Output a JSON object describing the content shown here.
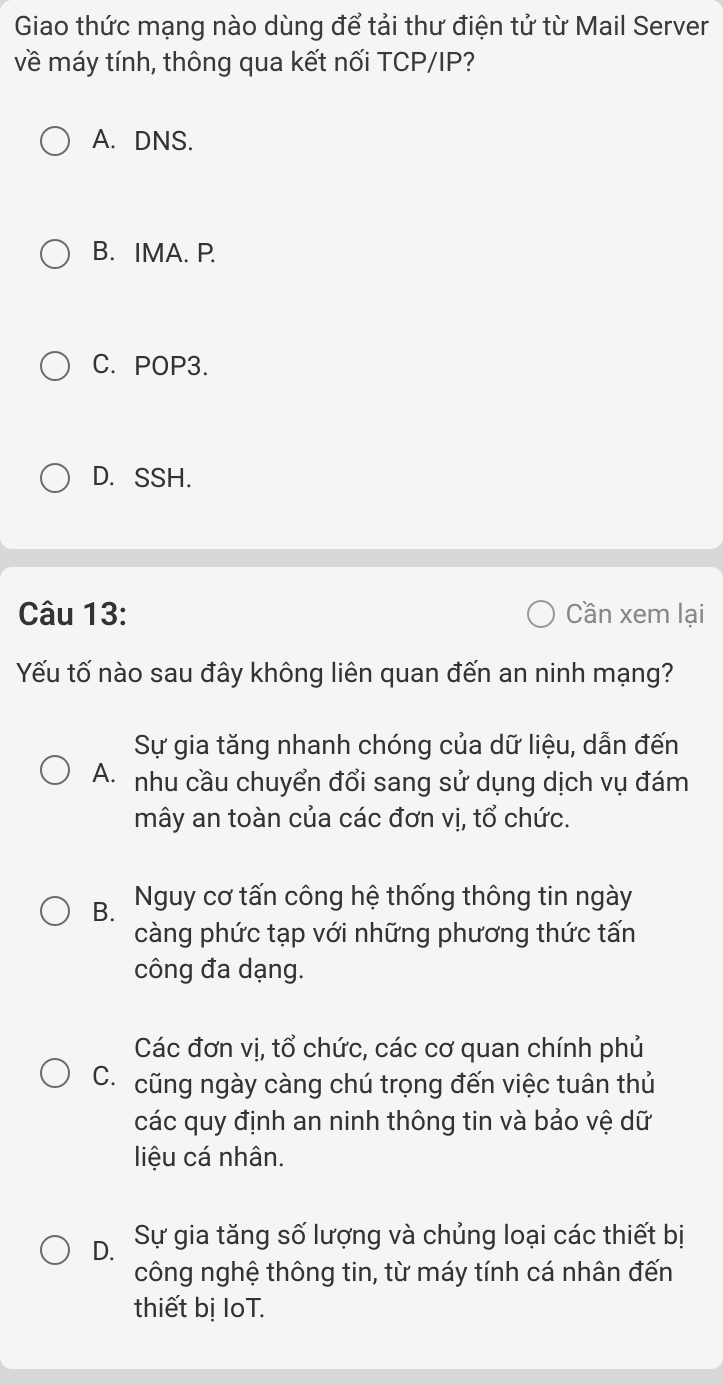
{
  "q12": {
    "prompt": "Giao thức mạng nào dùng để tải thư điện tử từ Mail Server về máy tính, thông qua kết nối TCP/IP?",
    "options": {
      "a": {
        "letter": "A.",
        "text": "DNS."
      },
      "b": {
        "letter": "B.",
        "text": "IMA. P."
      },
      "c": {
        "letter": "C.",
        "text": "POP3."
      },
      "d": {
        "letter": "D.",
        "text": "SSH."
      }
    }
  },
  "q13": {
    "number": "Câu 13:",
    "review_label": "Cần xem lại",
    "prompt": "Yếu tố nào sau đây không liên quan đến an ninh mạng?",
    "options": {
      "a": {
        "letter": "A.",
        "text": "Sự gia tăng nhanh chóng của dữ liệu, dẫn đến nhu cầu chuyển đổi sang sử dụng dịch vụ đám mây an toàn của các đơn vị, tổ chức."
      },
      "b": {
        "letter": "B.",
        "text": "Nguy cơ tấn công hệ thống thông tin ngày càng phức tạp với những phương thức tấn công đa dạng."
      },
      "c": {
        "letter": "C.",
        "text": "Các đơn vị, tổ chức, các cơ quan chính phủ cũng ngày càng chú trọng đến việc tuân thủ các quy định an ninh thông tin và bảo vệ dữ liệu cá nhân."
      },
      "d": {
        "letter": "D.",
        "text": "Sự gia tăng số lượng và chủng loại các thiết bị công nghệ thông tin, từ máy tính cá nhân đến thiết bị IoT."
      }
    }
  }
}
